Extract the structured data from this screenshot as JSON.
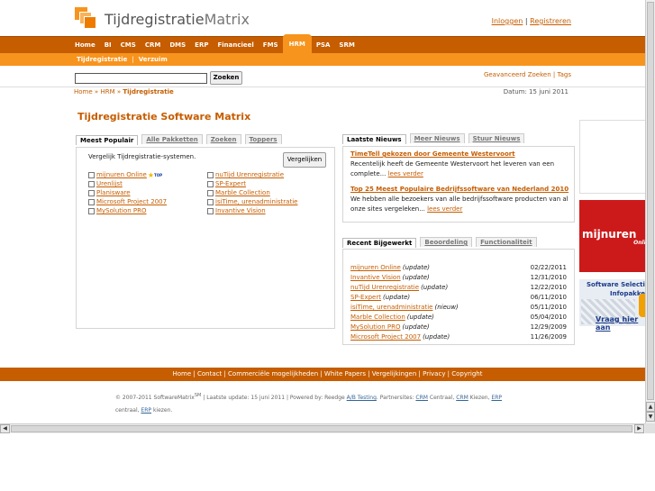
{
  "brand": {
    "name_part1": "Tijdregistratie",
    "name_part2": "Matrix"
  },
  "auth": {
    "login": "Inloggen",
    "sep": "|",
    "register": "Registreren"
  },
  "nav": {
    "items": [
      "Home",
      "BI",
      "CMS",
      "CRM",
      "DMS",
      "ERP",
      "Financieel",
      "FMS",
      "HRM",
      "PSA",
      "SRM"
    ],
    "active": "HRM"
  },
  "subnav": {
    "items": [
      "Tijdregistratie",
      "Verzuim"
    ],
    "sep": "|"
  },
  "search": {
    "value": "",
    "button": "Zoeken",
    "advanced": "Geavanceerd Zoeken",
    "sep": "|",
    "tags": "Tags"
  },
  "breadcrumb": {
    "home": "Home",
    "sep": "»",
    "hrm": "HRM",
    "current": "Tijdregistratie"
  },
  "date": "Datum: 15 juni 2011",
  "page_title": "Tijdregistratie Software Matrix",
  "compare": {
    "tabs": [
      "Meest Populair",
      "Alle Pakketten",
      "Zoeken",
      "Toppers"
    ],
    "intro": "Vergelijk Tijdregistratie-systemen.",
    "button": "Vergelijken",
    "col1": [
      "mijnuren Online",
      "Urenlijst",
      "Planisware",
      "Microsoft Project 2007",
      "MySolution PRO"
    ],
    "col2": [
      "nuTijd Urenregistratie",
      "SP-Expert",
      "Marble Collection",
      "isiTime, urenadministratie",
      "Invantive Vision"
    ],
    "top_badge": "TOP"
  },
  "news": {
    "tabs": [
      "Laatste Nieuws",
      "Meer Nieuws",
      "Stuur Nieuws"
    ],
    "items": [
      {
        "title": "TimeTell gekozen door Gemeente Westervoort",
        "body": "Recentelijk heeft de Gemeente Westervoort het leveren van een complete...",
        "more": "lees verder"
      },
      {
        "title": "Top 25 Meest Populaire Bedrijfssoftware van Nederland 2010",
        "body": "We hebben alle bezoekers van alle bedrijfssoftware producten van al onze sites vergeleken...",
        "more": "lees verder"
      }
    ]
  },
  "updates": {
    "tabs": [
      "Recent Bijgewerkt",
      "Beoordeling",
      "Functionaliteit"
    ],
    "rows": [
      {
        "name": "mijnuren Online",
        "tag": "(update)",
        "date": "02/22/2011"
      },
      {
        "name": "Invantive Vision",
        "tag": "(update)",
        "date": "12/31/2010"
      },
      {
        "name": "nuTijd Urenregistratie",
        "tag": "(update)",
        "date": "12/22/2010"
      },
      {
        "name": "SP-Expert",
        "tag": "(update)",
        "date": "06/11/2010"
      },
      {
        "name": "isiTime, urenadministratie",
        "tag": "(nieuw)",
        "date": "05/11/2010"
      },
      {
        "name": "Marble Collection",
        "tag": "(update)",
        "date": "05/04/2010"
      },
      {
        "name": "MySolution PRO",
        "tag": "(update)",
        "date": "12/29/2009"
      },
      {
        "name": "Microsoft Project 2007",
        "tag": "(update)",
        "date": "11/26/2009"
      }
    ]
  },
  "ads": {
    "mijnuren_big": "mijnuren",
    "mijnuren_small": "Online",
    "softsel_line1": "Software Selectie",
    "softsel_line2": "Infopakket",
    "softsel_link": "Vraag hier aan"
  },
  "footer": {
    "links": "Home | Contact | Commerciële mogelijkheden | White Papers | Vergelijkingen | Privacy | Copyright",
    "copyright_a": "© 2007-2011 SoftwareMatrix",
    "copyright_sm": "SM",
    "copyright_b": " | Laatste update: 15 juni 2011 | Powered by: Reedge ",
    "ab_testing": "A/B Testing",
    "partners": ". Partnersites: ",
    "crm1": "CRM",
    "centraal1": " Centraal, ",
    "crm2": "CRM",
    "kiezen1": " Kiezen, ",
    "erp1": "ERP",
    "centraal2": "centraal, ",
    "erp2": "ERP",
    "kiezen2": " kiezen."
  },
  "colors": {
    "nav": "#c65d00",
    "subnav": "#f7941d",
    "link": "#c65d00",
    "ad_red": "#cc1a1a"
  }
}
